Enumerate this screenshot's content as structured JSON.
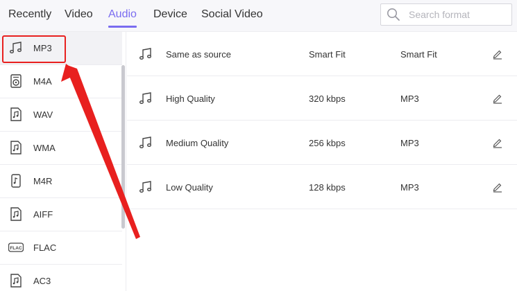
{
  "tabs": [
    {
      "label": "Recently"
    },
    {
      "label": "Video"
    },
    {
      "label": "Audio",
      "active": true
    },
    {
      "label": "Device"
    },
    {
      "label": "Social Video"
    }
  ],
  "search": {
    "placeholder": "Search format",
    "icon": "search-icon"
  },
  "sidebar": {
    "items": [
      {
        "label": "MP3",
        "icon": "music-note-icon",
        "selected": true
      },
      {
        "label": "M4A",
        "icon": "speaker-icon"
      },
      {
        "label": "WAV",
        "icon": "music-file-icon"
      },
      {
        "label": "WMA",
        "icon": "music-file-icon"
      },
      {
        "label": "M4R",
        "icon": "ringtone-file-icon"
      },
      {
        "label": "AIFF",
        "icon": "music-file-icon"
      },
      {
        "label": "FLAC",
        "icon": "flac-icon",
        "icon_text": "FLAC"
      },
      {
        "label": "AC3",
        "icon": "music-file-icon"
      }
    ]
  },
  "presets": [
    {
      "name": "Same as source",
      "bitrate": "Smart Fit",
      "format": "Smart Fit"
    },
    {
      "name": "High Quality",
      "bitrate": "320 kbps",
      "format": "MP3"
    },
    {
      "name": "Medium Quality",
      "bitrate": "256 kbps",
      "format": "MP3"
    },
    {
      "name": "Low Quality",
      "bitrate": "128 kbps",
      "format": "MP3"
    }
  ],
  "colors": {
    "accent": "#7a6cf0",
    "annotation": "#e8201f"
  }
}
